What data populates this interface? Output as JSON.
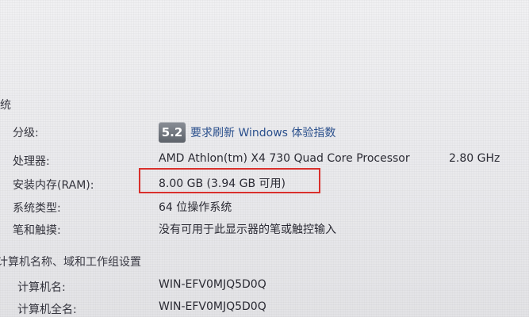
{
  "system": {
    "section_title": "系统",
    "rows": [
      {
        "label": "分级:",
        "badge": "5.2",
        "link": "要求刷新 Windows 体验指数"
      },
      {
        "label": "处理器:",
        "value": "AMD Athlon(tm) X4 730 Quad Core Processor",
        "extra": "2.80 GHz"
      },
      {
        "label": "安装内存(RAM):",
        "value": "8.00 GB (3.94 GB 可用)"
      },
      {
        "label": "系统类型:",
        "value": "64 位操作系统"
      },
      {
        "label": "笔和触摸:",
        "value": "没有可用于此显示器的笔或触控输入"
      }
    ]
  },
  "computer": {
    "section_title": "计算机名称、域和工作组设置",
    "rows": [
      {
        "label": "计算机名:",
        "value": "WIN-EFV0MJQ5D0Q"
      },
      {
        "label": "计算机全名:",
        "value": "WIN-EFV0MJQ5D0Q"
      }
    ]
  },
  "colors": {
    "highlight": "#d9302c",
    "link": "#2a4f8c"
  }
}
